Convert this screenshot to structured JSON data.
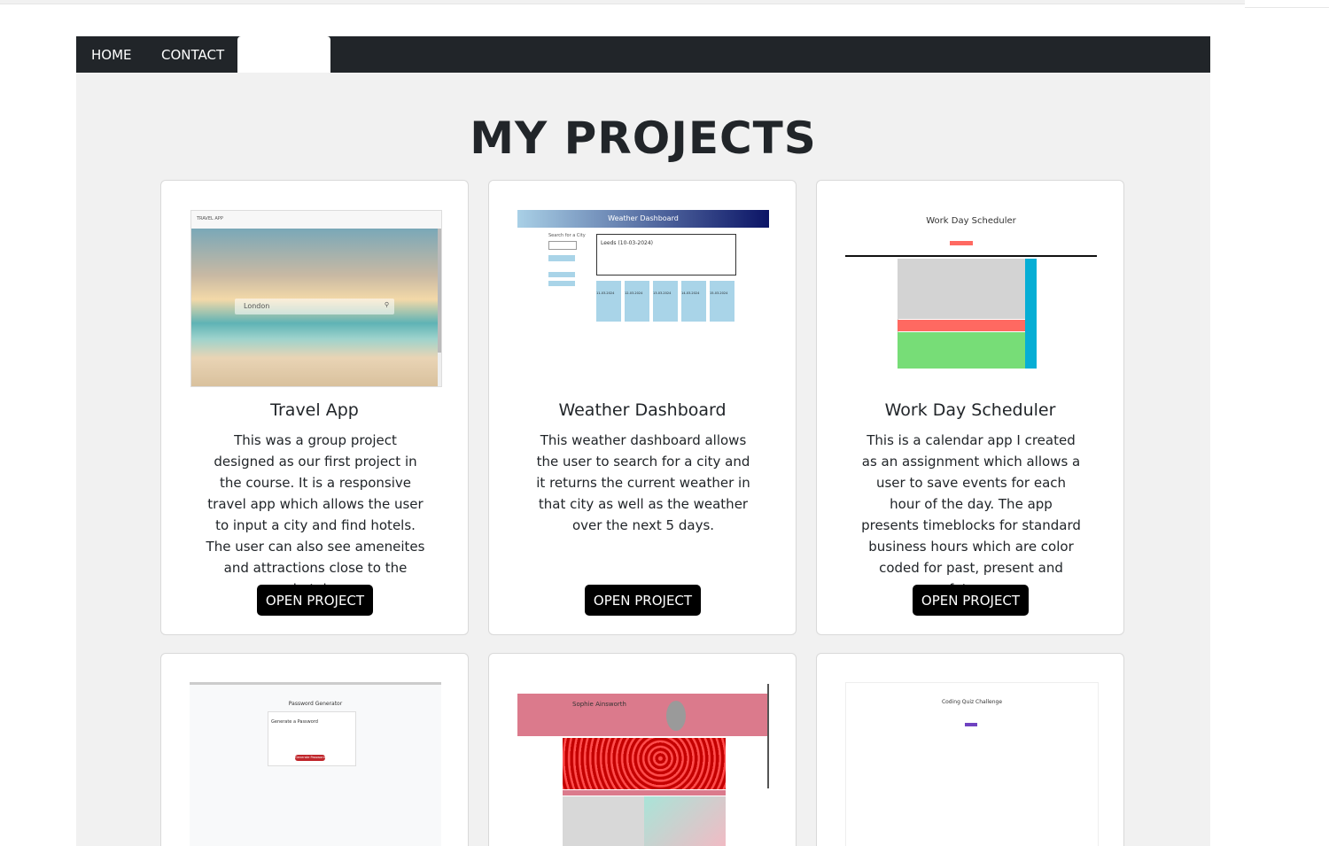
{
  "nav": {
    "home": "HOME",
    "contact": "CONTACT"
  },
  "page_title": "MY PROJECTS",
  "projects": [
    {
      "title": "Travel App",
      "description": "This was a group project designed as our first project in the course. It is a responsive travel app which allows the user to input a city and find hotels. The user can also see ameneites and attractions close to the hotels.",
      "button": "OPEN PROJECT",
      "thumb": {
        "brand": "TRAVEL APP",
        "search_value": "London"
      }
    },
    {
      "title": "Weather Dashboard",
      "description": "This weather dashboard allows the user to search for a city and it returns the current weather in that city as well as the weather over the next 5 days.",
      "button": "OPEN PROJECT",
      "thumb": {
        "header": "Weather Dashboard",
        "search_label": "Search for a City",
        "city": "Leeds (10-03-2024)",
        "days": [
          "11-03-2024",
          "12-03-2024",
          "13-03-2024",
          "14-03-2024",
          "15-03-2024"
        ]
      }
    },
    {
      "title": "Work Day Scheduler",
      "description": "This is a calendar app I created as an assignment which allows a user to save events for each hour of the day. The app presents timeblocks for standard business hours which are color coded for past, present and future.",
      "button": "OPEN PROJECT",
      "thumb": {
        "header": "Work Day Scheduler"
      }
    },
    {
      "thumb": {
        "header": "Password Generator",
        "sub": "Generate a Password",
        "button": "Generate Password"
      }
    },
    {
      "thumb": {
        "name": "Sophie Ainsworth"
      }
    },
    {
      "thumb": {
        "header": "Coding Quiz Challenge"
      }
    }
  ],
  "colors": {
    "nav_bg": "#212529",
    "page_bg": "#f1f1f1",
    "button_bg": "#000000",
    "past": "#d3d3d3",
    "present": "#ff6961",
    "future": "#77dd77",
    "save": "#06aed5"
  }
}
